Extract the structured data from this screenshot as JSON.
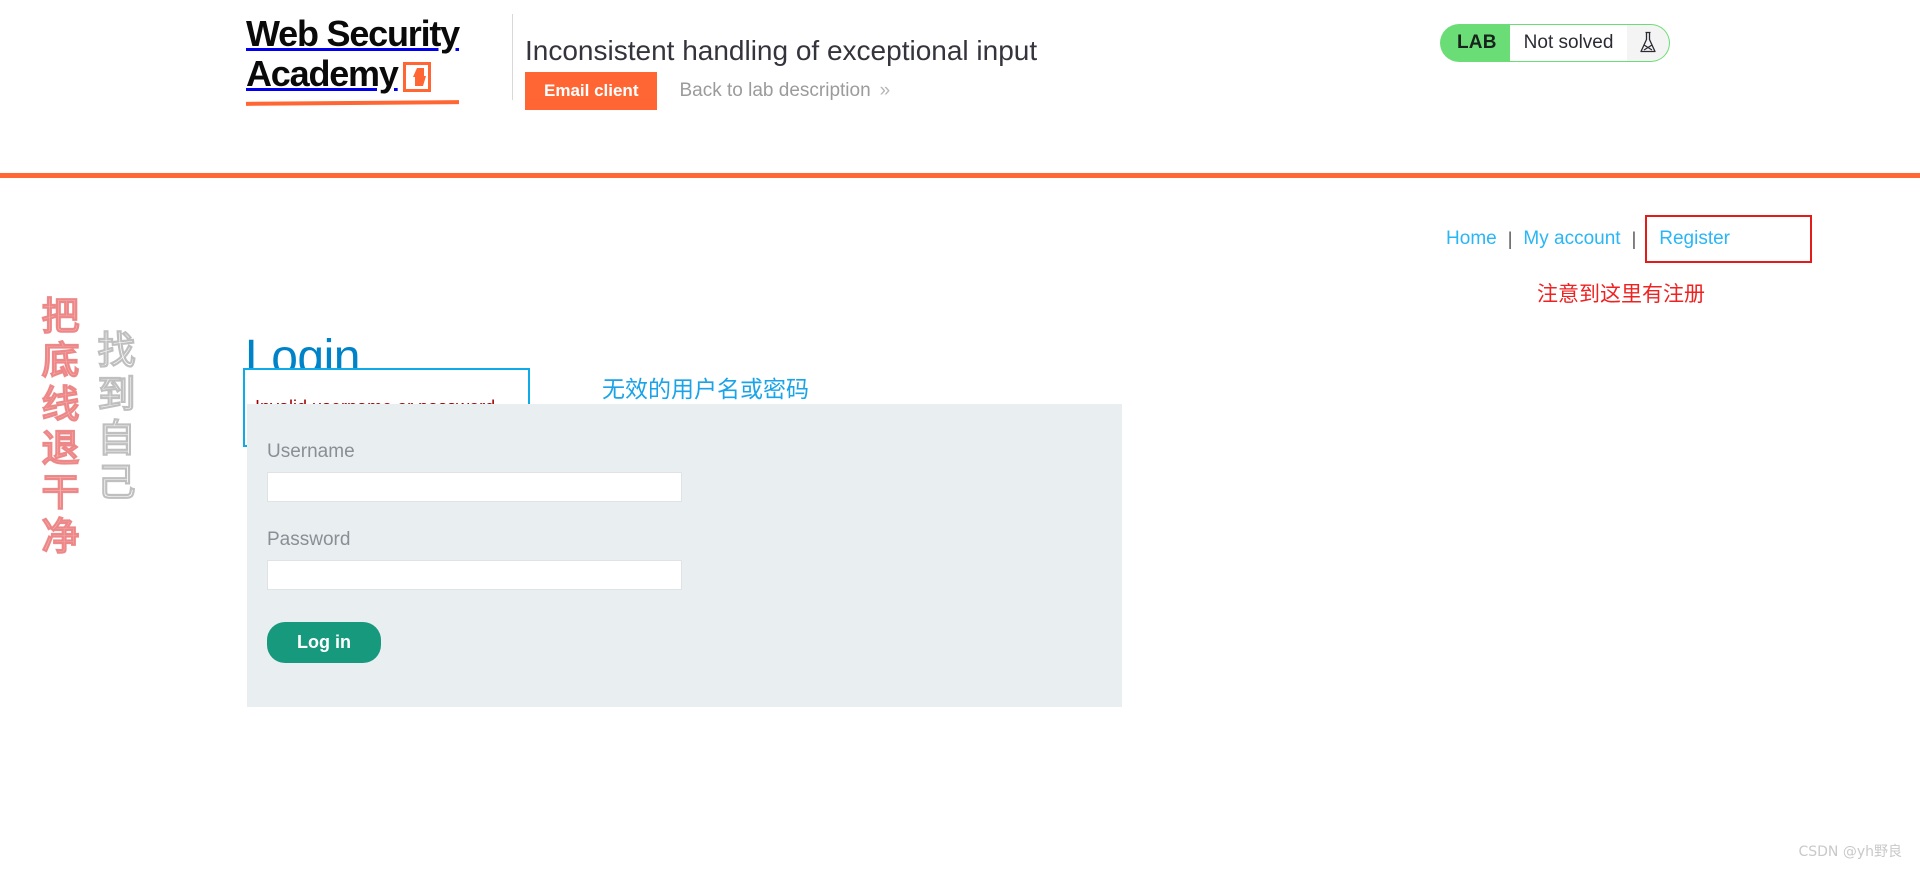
{
  "header": {
    "logo_line1": "Web Security",
    "logo_line2": "Academy",
    "logo_icon": "lightning-bolt-icon",
    "lab_title": "Inconsistent handling of exceptional input",
    "email_client_label": "Email client",
    "back_link_label": "Back to lab description",
    "back_link_chevron": "»",
    "status": {
      "tag": "LAB",
      "text": "Not solved",
      "icon": "flask-icon",
      "tag_color": "#6bdd77"
    },
    "accent_color": "#ff6633"
  },
  "nav": {
    "items": [
      {
        "label": "Home"
      },
      {
        "label": "My account"
      },
      {
        "label": "Register"
      }
    ],
    "separator": "|",
    "link_color": "#29b6f6",
    "highlight_color": "#e21b1b"
  },
  "annotations": {
    "register_note": "注意到这里有注册",
    "register_note_color": "#ef2222",
    "error_note": "无效的用户名或密码",
    "error_note_color": "#1aa3e8"
  },
  "main": {
    "page_title": "Login",
    "error_message": "Invalid username or password.",
    "error_text_color": "#a00000",
    "error_box_border_color": "#0faae8",
    "form": {
      "username_label": "Username",
      "username_value": "",
      "password_label": "Password",
      "password_value": "",
      "submit_label": "Log in",
      "submit_color": "#17997e",
      "background_color": "#e9eef1"
    }
  },
  "watermarks": {
    "vertical_red": "把底线退干净",
    "vertical_gray": "找到自己",
    "csdn": "CSDN @yh野良"
  }
}
